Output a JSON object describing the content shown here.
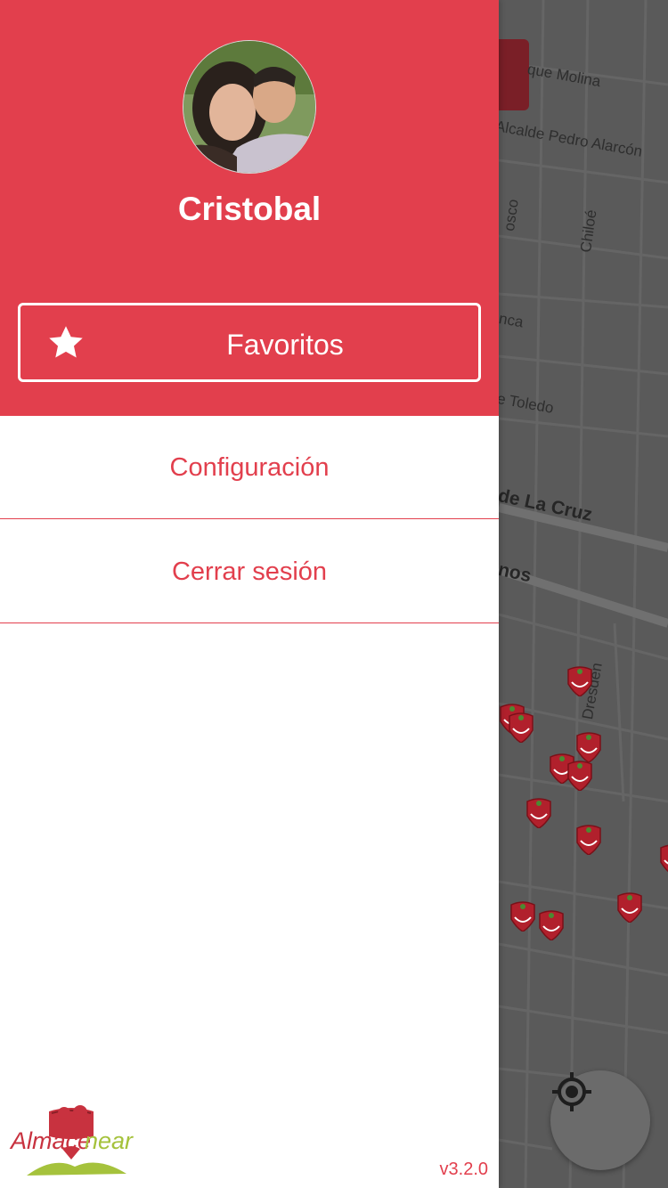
{
  "drawer": {
    "user_name": "Cristobal",
    "favorites_label": "Favoritos",
    "menu": [
      {
        "label": "Configuración"
      },
      {
        "label": "Cerrar sesión"
      }
    ],
    "version": "v3.2.0",
    "logo_text_1": "Almace",
    "logo_text_2": "near"
  },
  "map": {
    "streets": [
      "que Molina",
      "Alcalde Pedro Alarcón",
      "Chiloé",
      "osco",
      "nca",
      "e Toledo",
      "de La Cruz",
      "nos",
      "Dresden"
    ]
  },
  "colors": {
    "brand_red": "#e23f4d",
    "map_gray": "#5a5a5a"
  },
  "icons": {
    "favorites": "star-icon",
    "locate": "crosshair-icon"
  }
}
